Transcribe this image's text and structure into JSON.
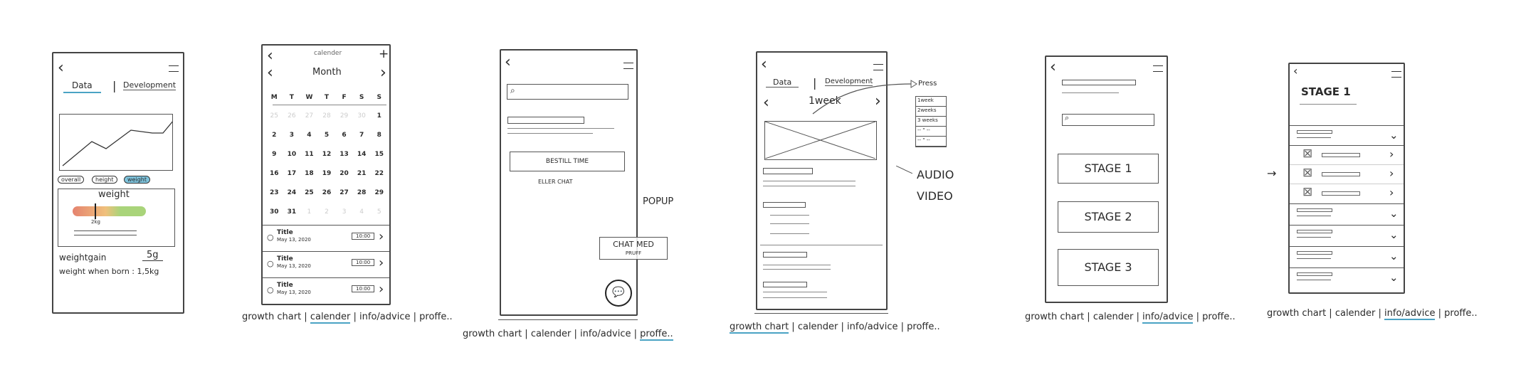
{
  "nav_items": [
    "growth chart",
    "calender",
    "info/advice",
    "proffe.."
  ],
  "accent": "#4aa3c4",
  "icons": {
    "back": "back-arrow-icon",
    "menu": "hamburger-menu-icon",
    "search": "search-icon",
    "chat": "chat-bubble-icon",
    "add": "plus-icon"
  },
  "screen1": {
    "tabs": [
      "Data",
      "Development"
    ],
    "filters": [
      "overall",
      "height",
      "weight"
    ],
    "active_filter": "weight",
    "gauge_title": "weight",
    "gauge_value": "2kg",
    "weightgain_label": "weightgain",
    "weightgain_value": "5g",
    "birth_weight": "weight when born : 1,5kg"
  },
  "screen2": {
    "title": "calender",
    "month": "Month",
    "weekdays": [
      "M",
      "T",
      "W",
      "T",
      "F",
      "S",
      "S"
    ],
    "days": [
      [
        "25",
        "26",
        "27",
        "28",
        "29",
        "30",
        "1"
      ],
      [
        "2",
        "3",
        "4",
        "5",
        "6",
        "7",
        "8"
      ],
      [
        "9",
        "10",
        "11",
        "12",
        "13",
        "14",
        "15"
      ],
      [
        "16",
        "17",
        "18",
        "19",
        "20",
        "21",
        "22"
      ],
      [
        "23",
        "24",
        "25",
        "26",
        "27",
        "28",
        "29"
      ],
      [
        "30",
        "31",
        "1",
        "2",
        "3",
        "4",
        "5"
      ]
    ],
    "events": [
      {
        "title": "Title",
        "date": "May 13, 2020",
        "time": "10:00"
      },
      {
        "title": "Title",
        "date": "May 13, 2020",
        "time": "10:00"
      },
      {
        "title": "Title",
        "date": "May 13, 2020",
        "time": "10:00"
      }
    ],
    "active_nav": "calender"
  },
  "screen3": {
    "book_button": "BESTILL TIME",
    "or_chat": "ELLER CHAT",
    "popup_label": "POPUP",
    "popup_text": "CHAT MED",
    "popup_sub": "PRUFF",
    "active_nav": "proffe.."
  },
  "screen4": {
    "tabs": [
      "Data",
      "Development"
    ],
    "week": "1week",
    "press_label": "Press",
    "week_options": [
      "1week",
      "2weeks",
      "3 weeks",
      "-- \" --",
      "-- \" --"
    ],
    "media_note": [
      "AUDIO",
      "VIDEO"
    ],
    "active_nav": "growth chart"
  },
  "screen5": {
    "stages": [
      "STAGE 1",
      "STAGE 2",
      "STAGE 3"
    ],
    "active_nav": "info/advice"
  },
  "screen6": {
    "title": "STAGE 1",
    "active_nav": "info/advice"
  }
}
